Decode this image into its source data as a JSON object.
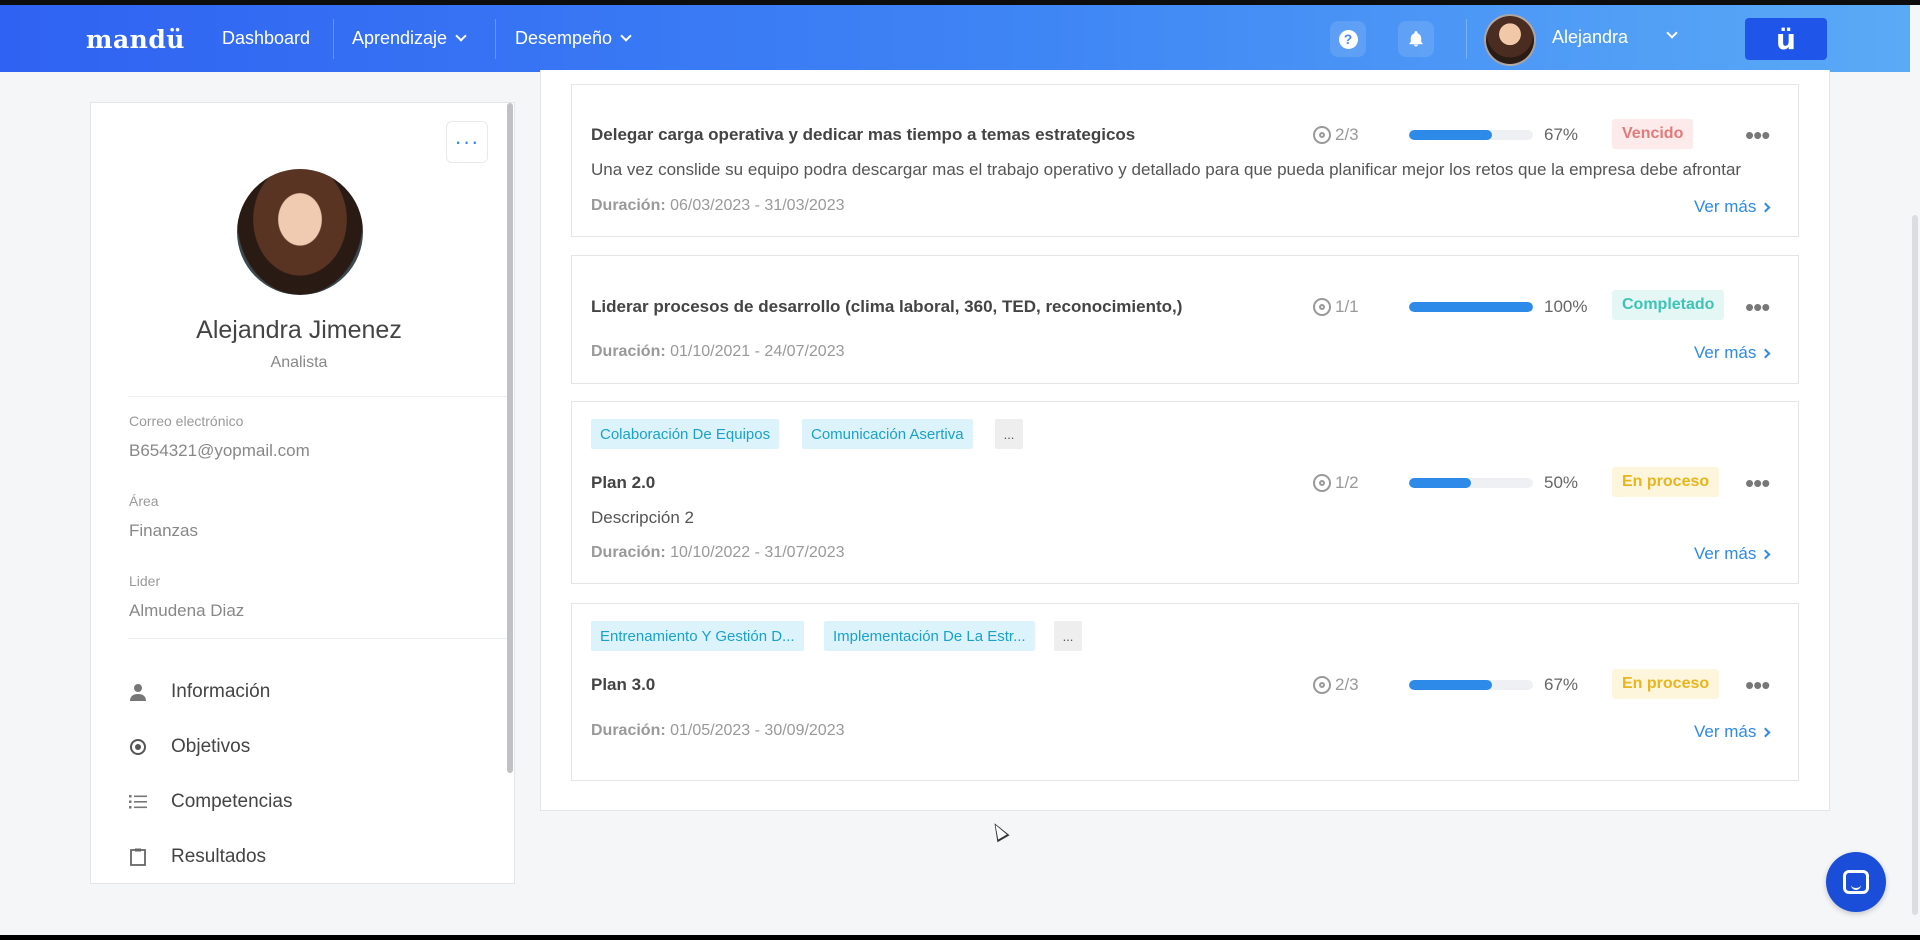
{
  "navbar": {
    "logo": "mandü",
    "items": [
      {
        "label": "Dashboard"
      },
      {
        "label": "Aprendizaje"
      },
      {
        "label": "Desempeño"
      }
    ],
    "help_glyph": "?",
    "user_name": "Alejandra",
    "brand_glyph": "ü"
  },
  "sidebar": {
    "more_glyph": "···",
    "name": "Alejandra Jimenez",
    "role": "Analista",
    "fields": [
      {
        "label": "Correo electrónico",
        "value": "B654321@yopmail.com"
      },
      {
        "label": "Área",
        "value": "Finanzas"
      },
      {
        "label": "Lider",
        "value": "Almudena Diaz"
      }
    ],
    "menu": [
      {
        "label": "Información",
        "icon": "user-icon"
      },
      {
        "label": "Objetivos",
        "icon": "target-icon"
      },
      {
        "label": "Competencias",
        "icon": "list-icon"
      },
      {
        "label": "Resultados",
        "icon": "clipboard-icon"
      }
    ]
  },
  "common": {
    "duration_label": "Duración:",
    "see_more": "Ver más",
    "dots": "•••",
    "tag_more": "..."
  },
  "plans": [
    {
      "title": "Delegar carga operativa y dedicar mas tiempo a temas estrategicos",
      "description": "Una vez conslide su equipo podra descargar mas el trabajo operativo y detallado para que pueda planificar mejor los retos que la empresa debe afrontar",
      "duration": "06/03/2023 - 31/03/2023",
      "goals": "2/3",
      "progress": 67,
      "progress_label": "67%",
      "status": "Vencido",
      "tags": []
    },
    {
      "title": "Liderar procesos de desarrollo (clima laboral, 360, TED, reconocimiento,)",
      "description": "",
      "duration": "01/10/2021 - 24/07/2023",
      "goals": "1/1",
      "progress": 100,
      "progress_label": "100%",
      "status": "Completado",
      "tags": []
    },
    {
      "title": "Plan 2.0",
      "description": "Descripción 2",
      "duration": "10/10/2022 - 31/07/2023",
      "goals": "1/2",
      "progress": 50,
      "progress_label": "50%",
      "status": "En proceso",
      "tags": [
        "Colaboración De Equipos",
        "Comunicación Asertiva"
      ]
    },
    {
      "title": "Plan 3.0",
      "description": "",
      "duration": "01/05/2023 - 30/09/2023",
      "goals": "2/3",
      "progress": 67,
      "progress_label": "67%",
      "status": "En proceso",
      "tags": [
        "Entrenamiento Y Gestión D...",
        "Implementación De La Estr..."
      ]
    }
  ],
  "colors": {
    "accent": "#2d8ae8",
    "navbar_start": "#2f62f2",
    "navbar_end": "#5aaaf6",
    "status_overdue": "#e27a7a",
    "status_done": "#3fc3b5",
    "status_progress": "#e9b51c"
  }
}
